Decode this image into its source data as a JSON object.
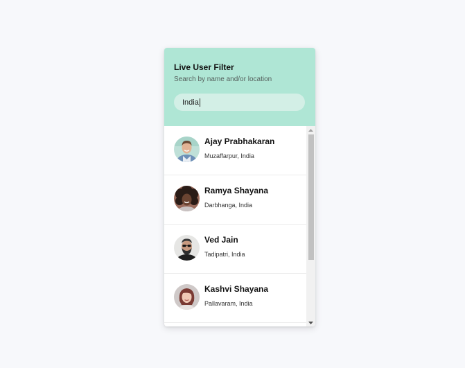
{
  "header": {
    "title": "Live User Filter",
    "subtitle": "Search by name and/or location"
  },
  "search": {
    "value": "India"
  },
  "users": [
    {
      "name": "Ajay Prabhakaran",
      "location": "Muzaffarpur, India",
      "avatar": "man-smiling-avatar"
    },
    {
      "name": "Ramya Shayana",
      "location": "Darbhanga, India",
      "avatar": "woman-curly-hair-avatar"
    },
    {
      "name": "Ved Jain",
      "location": "Tadipatri, India",
      "avatar": "man-beard-sunglasses-avatar"
    },
    {
      "name": "Kashvi Shayana",
      "location": "Pallavaram, India",
      "avatar": "woman-red-hair-avatar"
    }
  ],
  "colors": {
    "header_bg": "#afe6d5",
    "search_bg": "#d3efe6",
    "page_bg": "#f7f8fb"
  }
}
